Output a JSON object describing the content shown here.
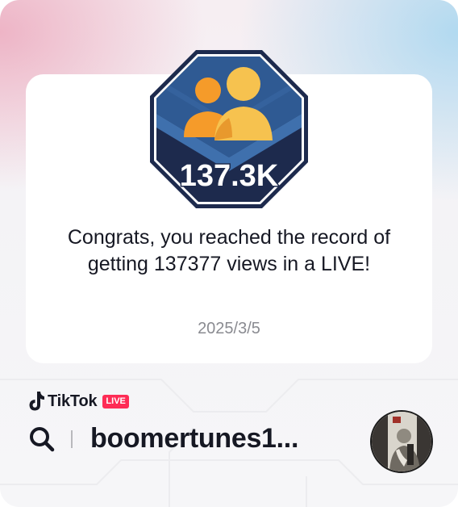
{
  "badge": {
    "icon": "two-people-icon",
    "value_label": "137.3K",
    "colors": {
      "outer": "#1d2a4d",
      "top": "#315b94",
      "stripe": "#3c6ca8",
      "person_front": "#f6c24f",
      "person_back": "#f59b2a"
    }
  },
  "card": {
    "message": "Congrats, you reached the record of getting 137377 views in a LIVE!",
    "date": "2025/3/5"
  },
  "footer": {
    "brand_name": "TikTok",
    "live_label": "LIVE",
    "username": "boomertunes1...",
    "search_icon": "search-icon",
    "avatar_icon": "avatar"
  },
  "colors": {
    "live": "#fe2c55",
    "text": "#161823",
    "muted": "#8a8b91"
  }
}
